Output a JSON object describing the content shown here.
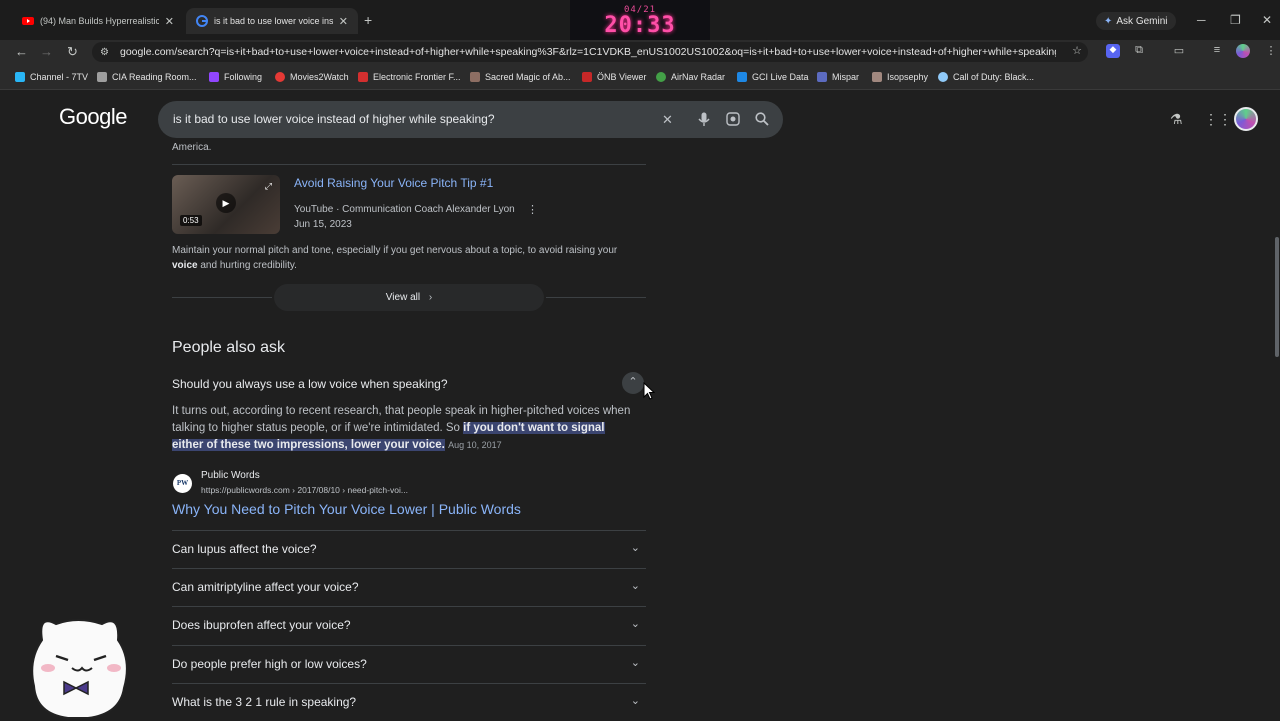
{
  "tabs": [
    {
      "title": "(94) Man Builds Hyperrealistic M",
      "favicon": "youtube-icon",
      "color": "#ff0000"
    },
    {
      "title": "is it bad to use lower voice inste",
      "favicon": "google-icon",
      "color": "#4285f4"
    }
  ],
  "new_tab": "+",
  "overlay_clock": {
    "date": "04/21",
    "time": "20:33"
  },
  "ask_gemini": "Ask Gemini",
  "address_bar": {
    "url": "google.com/search?q=is+it+bad+to+use+lower+voice+instead+of+higher+while+speaking%3F&rlz=1C1VDKB_enUS1002US1002&oq=is+it+bad+to+use+lower+voice+instead+of+higher+while+speaking..."
  },
  "bookmarks": [
    {
      "label": "Channel - 7TV",
      "color": "#29b6f6"
    },
    {
      "label": "CIA Reading Room...",
      "color": "#9e9e9e"
    },
    {
      "label": "Following",
      "color": "#9146ff"
    },
    {
      "label": "Movies2Watch",
      "color": "#e53935"
    },
    {
      "label": "Electronic Frontier F...",
      "color": "#d32f2f"
    },
    {
      "label": "Sacred Magic of Ab...",
      "color": "#8d6e63"
    },
    {
      "label": "ÖNB Viewer",
      "color": "#c62828"
    },
    {
      "label": "AirNav Radar",
      "color": "#43a047"
    },
    {
      "label": "GCI Live Data",
      "color": "#1e88e5"
    },
    {
      "label": "Mispar",
      "color": "#5c6bc0"
    },
    {
      "label": "Isopsephy",
      "color": "#a1887f"
    },
    {
      "label": "Call of Duty: Black...",
      "color": "#90caf9"
    }
  ],
  "google": {
    "logo": "Google",
    "query": "is it bad to use lower voice instead of higher while speaking?"
  },
  "prev_fragment": "America.",
  "video": {
    "title": "Avoid Raising Your Voice Pitch Tip #1",
    "source": "YouTube · Communication Coach Alexander Lyon",
    "date": "Jun 15, 2023",
    "duration": "0:53",
    "desc_before": "Maintain your normal pitch and tone, especially if you get nervous about a topic, to avoid raising your ",
    "desc_bold": "voice",
    "desc_after": " and hurting credibility."
  },
  "view_all": "View all",
  "people_also_ask": {
    "heading": "People also ask",
    "expanded_question": "Should you always use a low voice when speaking?",
    "answer_plain": "It turns out, according to recent research, that people speak in higher-pitched voices when talking to higher status people, or if we're intimidated. So ",
    "answer_highlight": "if you don't want to signal either of these two impressions, lower your voice.",
    "answer_date": "Aug 10, 2017",
    "source_icon_text": "PW",
    "source_name": "Public Words",
    "source_url": "https://publicwords.com › 2017/08/10 › need-pitch-voi...",
    "source_title": "Why You Need to Pitch Your Voice Lower | Public Words",
    "questions": [
      "Can lupus affect the voice?",
      "Can amitriptyline affect your voice?",
      "Does ibuprofen affect your voice?",
      "Do people prefer high or low voices?",
      "What is the 3 2 1 rule in speaking?"
    ]
  }
}
